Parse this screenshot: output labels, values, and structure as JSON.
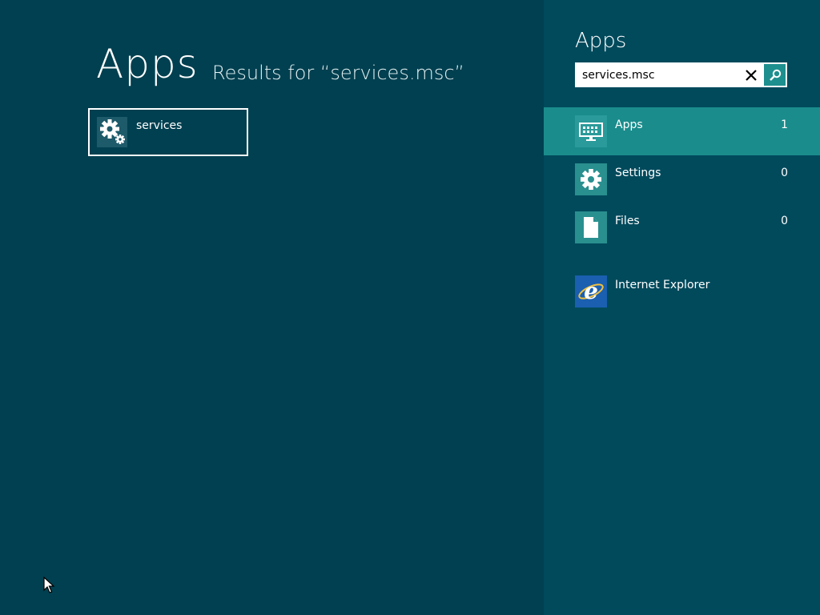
{
  "main": {
    "title": "Apps",
    "subtitle": "Results for “services.msc”",
    "results": [
      {
        "label": "services",
        "icon": "gears-icon"
      }
    ]
  },
  "pane": {
    "title": "Apps",
    "search": {
      "value": "services.msc",
      "placeholder": ""
    },
    "items": [
      {
        "label": "Apps",
        "count": "1",
        "icon": "keyboard-icon",
        "selected": true
      },
      {
        "label": "Settings",
        "count": "0",
        "icon": "gear-icon",
        "selected": false
      },
      {
        "label": "Files",
        "count": "0",
        "icon": "file-icon",
        "selected": false
      }
    ],
    "extra_apps": [
      {
        "label": "Internet Explorer",
        "icon": "internet-explorer-icon"
      }
    ]
  },
  "colors": {
    "main_bg": "#004050",
    "pane_bg": "#004a5c",
    "selected_bg": "#1a8c8c",
    "accent": "#1e8f8f"
  }
}
